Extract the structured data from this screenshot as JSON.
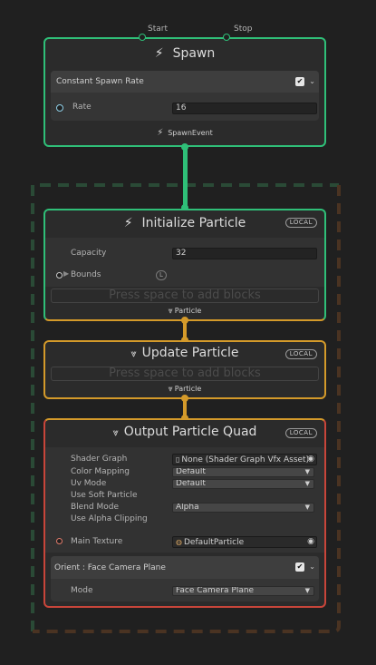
{
  "spawn": {
    "title": "Spawn",
    "start_label": "Start",
    "stop_label": "Stop",
    "block_title": "Constant Spawn Rate",
    "rate_label": "Rate",
    "rate_value": "16",
    "event_label": "SpawnEvent"
  },
  "initialize": {
    "title": "Initialize Particle",
    "badge": "LOCAL",
    "capacity_label": "Capacity",
    "capacity_value": "32",
    "bounds_label": "Bounds",
    "bounds_badge": "L",
    "placeholder": "Press space to add blocks",
    "flow_label": "Particle"
  },
  "update": {
    "title": "Update Particle",
    "badge": "LOCAL",
    "placeholder": "Press space to add blocks",
    "flow_label": "Particle"
  },
  "output": {
    "title": "Output Particle Quad",
    "badge": "LOCAL",
    "shader_graph_label": "Shader Graph",
    "shader_graph_value": "None (Shader Graph Vfx Asset)",
    "color_mapping_label": "Color Mapping",
    "color_mapping_value": "Default",
    "uv_mode_label": "Uv Mode",
    "uv_mode_value": "Default",
    "use_soft_particle_label": "Use Soft Particle",
    "blend_mode_label": "Blend Mode",
    "blend_mode_value": "Alpha",
    "use_alpha_clipping_label": "Use Alpha Clipping",
    "main_texture_label": "Main Texture",
    "main_texture_value": "DefaultParticle",
    "orient_block_title": "Orient : Face Camera Plane",
    "mode_label": "Mode",
    "mode_value": "Face Camera Plane"
  },
  "colors": {
    "spawn_border": "#2fbf78",
    "context_border": "#d49a2a",
    "output_border": "#c8453a",
    "system_green": "#2a4a36",
    "system_brown": "#4a3322"
  }
}
